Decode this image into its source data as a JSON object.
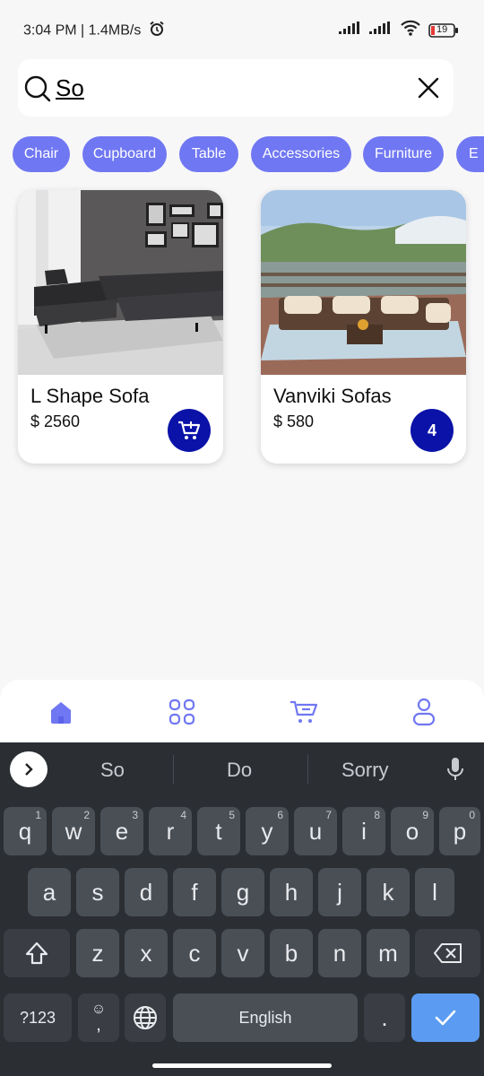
{
  "status_bar": {
    "time": "3:04 PM | 1.4MB/s",
    "battery": "19"
  },
  "search": {
    "value": "So",
    "placeholder": ""
  },
  "categories": [
    "Chair",
    "Cupboard",
    "Table",
    "Accessories",
    "Furniture",
    "E"
  ],
  "products": [
    {
      "name": "L Shape Sofa",
      "price": "$ 2560",
      "action": "add-to-cart"
    },
    {
      "name": "Vanviki Sofas",
      "price": "$ 580",
      "cart_count": "4"
    }
  ],
  "bottom_nav": {
    "items": [
      "home-icon",
      "grid-icon",
      "cart-icon",
      "profile-icon"
    ],
    "active": "home-icon"
  },
  "keyboard": {
    "suggestions": [
      "So",
      "Do",
      "Sorry"
    ],
    "row1": [
      {
        "k": "q",
        "hint": "1"
      },
      {
        "k": "w",
        "hint": "2"
      },
      {
        "k": "e",
        "hint": "3"
      },
      {
        "k": "r",
        "hint": "4"
      },
      {
        "k": "t",
        "hint": "5"
      },
      {
        "k": "y",
        "hint": "6"
      },
      {
        "k": "u",
        "hint": "7"
      },
      {
        "k": "i",
        "hint": "8"
      },
      {
        "k": "o",
        "hint": "9"
      },
      {
        "k": "p",
        "hint": "0"
      }
    ],
    "row2": [
      "a",
      "s",
      "d",
      "f",
      "g",
      "h",
      "j",
      "k",
      "l"
    ],
    "row3": [
      "z",
      "x",
      "c",
      "v",
      "b",
      "n",
      "m"
    ],
    "symbols_label": "?123",
    "comma_label": ",",
    "space_label": "English",
    "period_label": "."
  },
  "colors": {
    "accent": "#7077f2",
    "action": "#0a12a8",
    "keyboard_bg": "#2b2f34",
    "key_bg": "#4a4f56",
    "enter_key": "#5b9cf2"
  }
}
